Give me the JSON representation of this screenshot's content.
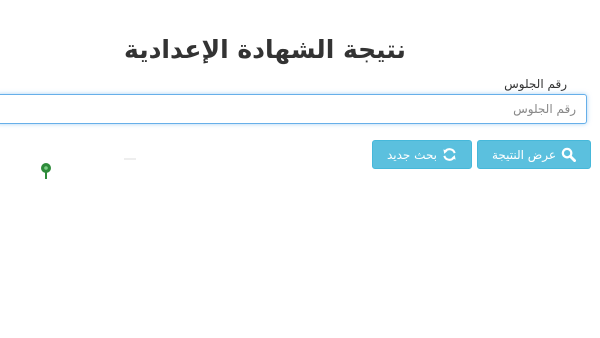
{
  "page": {
    "title": "نتيجة الشهادة الإعدادية"
  },
  "form": {
    "seat_label": "رقم الجلوس",
    "seat_input": {
      "value": "",
      "placeholder": "رقم الجلوس"
    },
    "show_result_button": "عرض النتيجة",
    "new_search_button": "بحث جديد"
  },
  "colors": {
    "button_bg": "#5bc0de",
    "input_focus_border": "#66afe9",
    "pin": "#2e8b3a"
  },
  "icons": {
    "show_result": "search-icon",
    "new_search": "refresh-icon",
    "marker": "map-pin-icon"
  }
}
